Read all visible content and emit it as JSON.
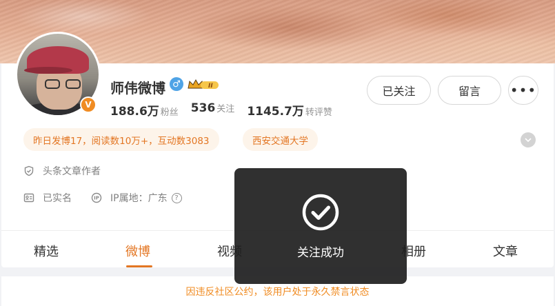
{
  "profile": {
    "name": "师伟微博",
    "gender_symbol": "♂",
    "verified_badge": "V",
    "level_badge": "II",
    "stats": [
      {
        "value": "188.6万",
        "label": "粉丝"
      },
      {
        "value": "536",
        "label": "关注"
      },
      {
        "value": "1145.7万",
        "label": "转评赞"
      }
    ]
  },
  "actions": {
    "followed_label": "已关注",
    "message_label": "留言",
    "more_label": "•••"
  },
  "tags": {
    "activity": "昨日发博17，阅读数10万+，互动数3083",
    "school": "西安交通大学"
  },
  "info": {
    "role": "头条文章作者",
    "realname": "已实名",
    "ip_location": "IP属地：广东",
    "ip_help": "?"
  },
  "tabs": [
    {
      "label": "精选"
    },
    {
      "label": "微博",
      "active": true
    },
    {
      "label": "视频"
    },
    {
      "label": "相册"
    },
    {
      "label": "文章"
    }
  ],
  "notice": "因违反社区公约，该用户处于永久禁言状态",
  "toast": {
    "icon": "check-circle-icon",
    "text": "关注成功"
  },
  "colors": {
    "accent": "#e37623",
    "verified": "#f08c23",
    "gender": "#4fa3e6"
  }
}
